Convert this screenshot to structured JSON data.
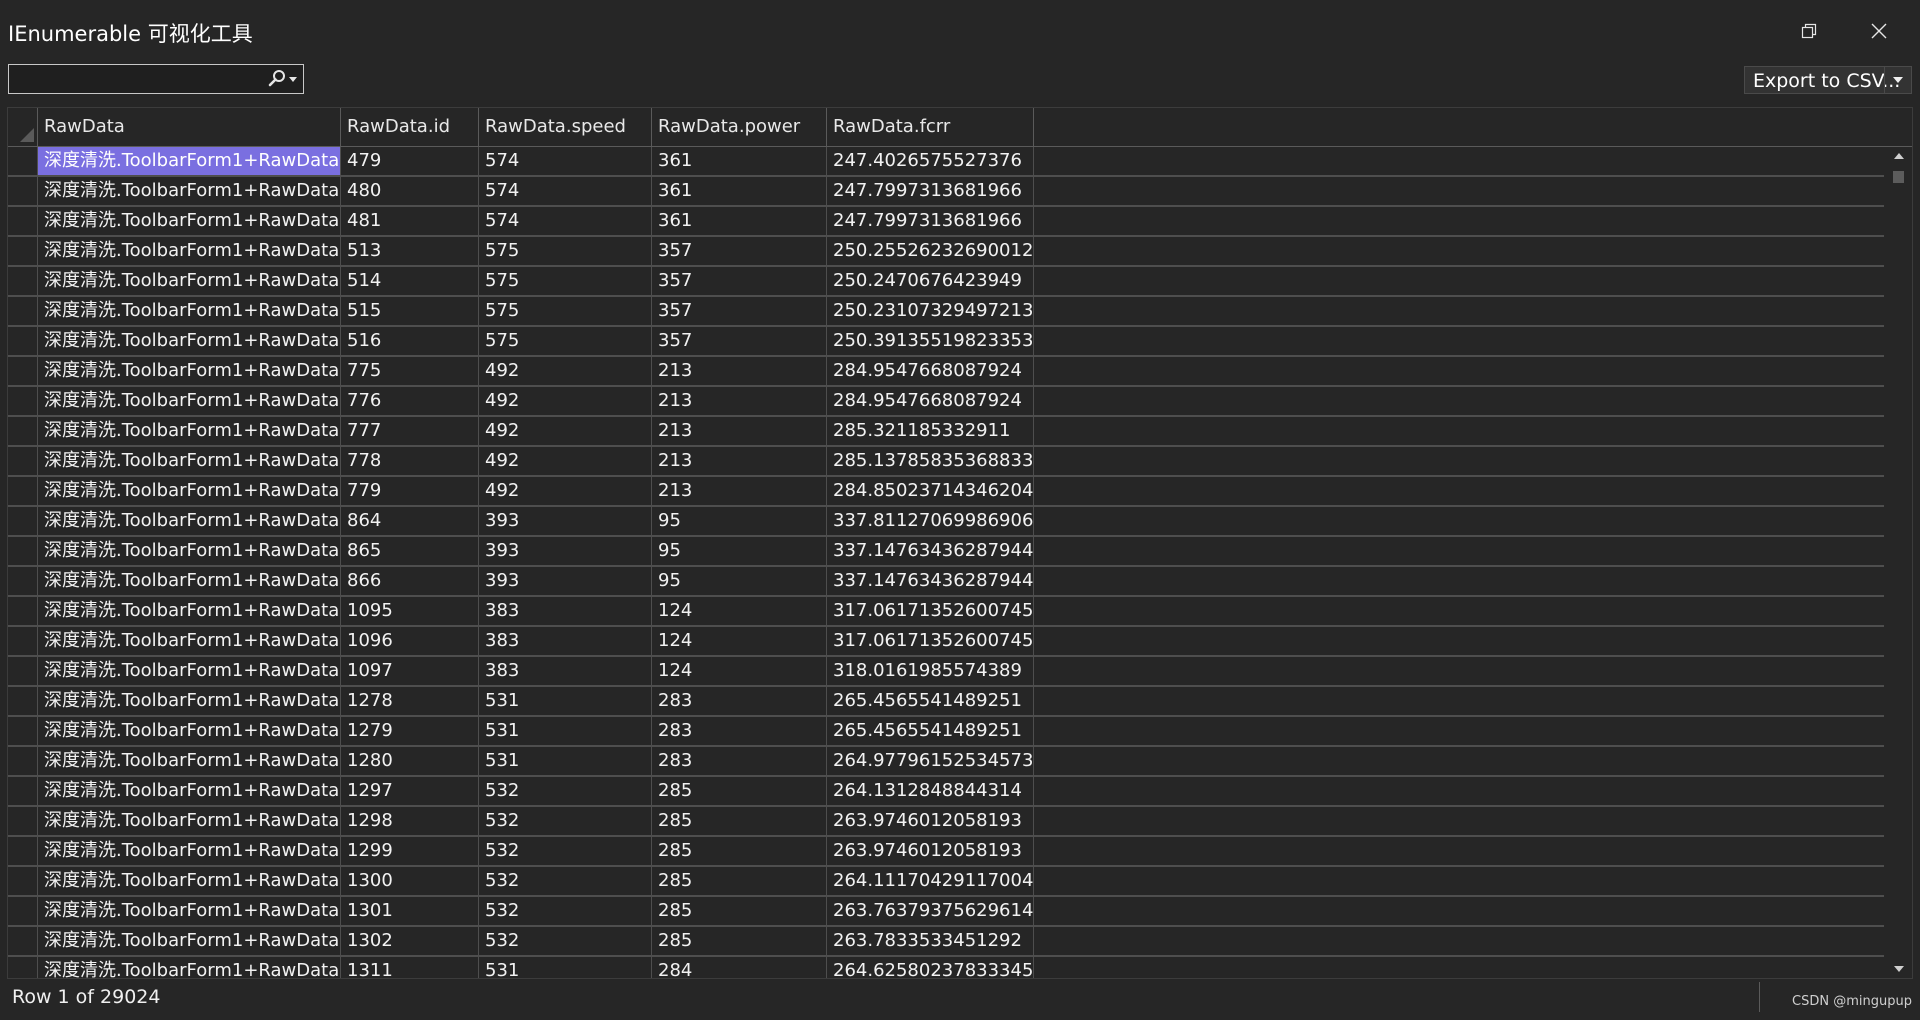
{
  "window": {
    "title": "IEnumerable 可视化工具"
  },
  "toolbar": {
    "search_value": "",
    "search_placeholder": "",
    "export_label": "Export to CSV..."
  },
  "grid": {
    "columns": [
      "RawData",
      "RawData.id",
      "RawData.speed",
      "RawData.power",
      "RawData.fcrr"
    ],
    "rows": [
      [
        "深度清洗.ToolbarForm1+RawData",
        "479",
        "574",
        "361",
        "247.4026575527376"
      ],
      [
        "深度清洗.ToolbarForm1+RawData",
        "480",
        "574",
        "361",
        "247.7997313681966"
      ],
      [
        "深度清洗.ToolbarForm1+RawData",
        "481",
        "574",
        "361",
        "247.7997313681966"
      ],
      [
        "深度清洗.ToolbarForm1+RawData",
        "513",
        "575",
        "357",
        "250.25526232690012"
      ],
      [
        "深度清洗.ToolbarForm1+RawData",
        "514",
        "575",
        "357",
        "250.2470676423949"
      ],
      [
        "深度清洗.ToolbarForm1+RawData",
        "515",
        "575",
        "357",
        "250.23107329497213"
      ],
      [
        "深度清洗.ToolbarForm1+RawData",
        "516",
        "575",
        "357",
        "250.39135519823353"
      ],
      [
        "深度清洗.ToolbarForm1+RawData",
        "775",
        "492",
        "213",
        "284.9547668087924"
      ],
      [
        "深度清洗.ToolbarForm1+RawData",
        "776",
        "492",
        "213",
        "284.9547668087924"
      ],
      [
        "深度清洗.ToolbarForm1+RawData",
        "777",
        "492",
        "213",
        "285.321185332911"
      ],
      [
        "深度清洗.ToolbarForm1+RawData",
        "778",
        "492",
        "213",
        "285.13785835368833"
      ],
      [
        "深度清洗.ToolbarForm1+RawData",
        "779",
        "492",
        "213",
        "284.85023714346204"
      ],
      [
        "深度清洗.ToolbarForm1+RawData",
        "864",
        "393",
        "95",
        "337.81127069986906"
      ],
      [
        "深度清洗.ToolbarForm1+RawData",
        "865",
        "393",
        "95",
        "337.14763436287944"
      ],
      [
        "深度清洗.ToolbarForm1+RawData",
        "866",
        "393",
        "95",
        "337.14763436287944"
      ],
      [
        "深度清洗.ToolbarForm1+RawData",
        "1095",
        "383",
        "124",
        "317.06171352600745"
      ],
      [
        "深度清洗.ToolbarForm1+RawData",
        "1096",
        "383",
        "124",
        "317.06171352600745"
      ],
      [
        "深度清洗.ToolbarForm1+RawData",
        "1097",
        "383",
        "124",
        "318.0161985574389"
      ],
      [
        "深度清洗.ToolbarForm1+RawData",
        "1278",
        "531",
        "283",
        "265.4565541489251"
      ],
      [
        "深度清洗.ToolbarForm1+RawData",
        "1279",
        "531",
        "283",
        "265.4565541489251"
      ],
      [
        "深度清洗.ToolbarForm1+RawData",
        "1280",
        "531",
        "283",
        "264.97796152534573"
      ],
      [
        "深度清洗.ToolbarForm1+RawData",
        "1297",
        "532",
        "285",
        "264.1312848844314"
      ],
      [
        "深度清洗.ToolbarForm1+RawData",
        "1298",
        "532",
        "285",
        "263.9746012058193"
      ],
      [
        "深度清洗.ToolbarForm1+RawData",
        "1299",
        "532",
        "285",
        "263.9746012058193"
      ],
      [
        "深度清洗.ToolbarForm1+RawData",
        "1300",
        "532",
        "285",
        "264.11170429117004"
      ],
      [
        "深度清洗.ToolbarForm1+RawData",
        "1301",
        "532",
        "285",
        "263.76379375629614"
      ],
      [
        "深度清洗.ToolbarForm1+RawData",
        "1302",
        "532",
        "285",
        "263.7833533451292"
      ],
      [
        "深度清洗.ToolbarForm1+RawData",
        "1311",
        "531",
        "284",
        "264.62580237833345"
      ]
    ],
    "selected_row": 0,
    "selected_col": 0
  },
  "status": {
    "text": "Row 1 of 29024",
    "watermark": "CSDN @mingupup"
  },
  "colors": {
    "background": "#262626",
    "selection": "#7a6fe0",
    "gridline": "#4e4e4e"
  },
  "icons": {
    "restore": "restore-icon",
    "close": "close-icon",
    "search": "search-icon",
    "dropdown": "chevron-down-icon",
    "scroll_up": "scroll-up-arrow-icon",
    "scroll_down": "scroll-down-arrow-icon"
  }
}
